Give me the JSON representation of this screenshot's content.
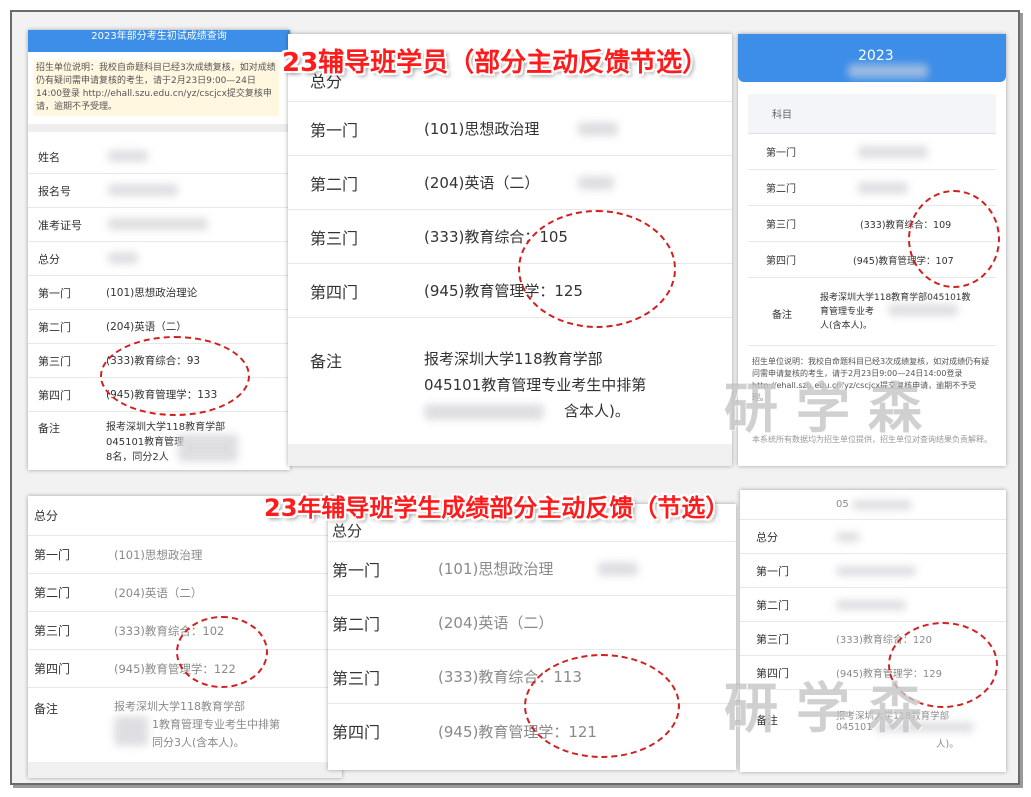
{
  "banners": {
    "top": "23辅导班学员（部分主动反馈节选）",
    "bottom": "23年辅导班学生成绩部分主动反馈（节选）"
  },
  "watermark": "研学森",
  "labels": {
    "name": "姓名",
    "reg_no": "报名号",
    "ticket": "准考证号",
    "total": "总分",
    "first": "第一门",
    "second": "第二门",
    "third": "第三门",
    "fourth": "第四门",
    "remark": "备注",
    "subject": "科目"
  },
  "panel1": {
    "header": "2023年部分考生初试成绩查询",
    "notice": "招生单位说明：我校自命题科目已经3次成绩复核，如对成绩仍有疑问需申请复核的考生，请于2月23日9:00—24日14:00登录 http://ehall.szu.edu.cn/yz/cscjcx提交复核申请，逾期不予受理。",
    "s1": "(101)思想政治理论",
    "s2": "(204)英语（二）",
    "s3": "(333)教育综合：93",
    "s4": "(945)教育管理学：133",
    "remark_l1": "报考深圳大学118教育学部",
    "remark_l2": "045101教育管理",
    "remark_l3": "8名，同分2人"
  },
  "panel2": {
    "s1": "(101)思想政治理",
    "s2": "(204)英语（二）",
    "s3": "(333)教育综合：105",
    "s4": "(945)教育管理学：125",
    "remark_l1": "报考深圳大学118教育学部",
    "remark_l2": "045101教育管理专业考生中排第",
    "remark_l3": "含本人)。"
  },
  "panel3": {
    "header": "2023",
    "s3": "(333)教育综合：109",
    "s4": "(945)教育管理学：107",
    "remark_l1": "报考深圳大学118教育学部045101教",
    "remark_l2": "育管理专业考",
    "remark_l3": "人(含本人)。",
    "notice": "招生单位说明：我校自命题科目已经3次成绩复核，如对成绩仍有疑问需申请复核的考生，请于2月23日9:00—24日14:00登录 http://ehall.szu.edu.cn/yz/cscjcx提交复核申请，逾期不予受理。",
    "footer": "本系统所有数据均为招生单位提供，招生单位对查询结果负责解释。"
  },
  "panel4": {
    "s1": "(101)思想政治理",
    "s2": "(204)英语（二）",
    "s3": "(333)教育综合：102",
    "s4": "(945)教育管理学：122",
    "remark_l1": "报考深圳大学118教育学部",
    "remark_l2": "1教育管理专业考生中排第",
    "remark_l3": "同分3人(含本人)。"
  },
  "panel5": {
    "s1": "(101)思想政治理",
    "s2": "(204)英语（二）",
    "s3": "(333)教育综合：113",
    "s4": "(945)教育管理学：121"
  },
  "panel6": {
    "head_code": "05",
    "s3": "(333)教育综合：120",
    "s4": "(945)教育管理学：129",
    "remark_l1": "报考深圳大学118教育学部",
    "remark_l2": "045101",
    "remark_l3": "人)。"
  },
  "colors": {
    "banner_red": "#ff1b1b",
    "circle_red": "#d21f1f",
    "header_blue": "#3d8ee8"
  }
}
